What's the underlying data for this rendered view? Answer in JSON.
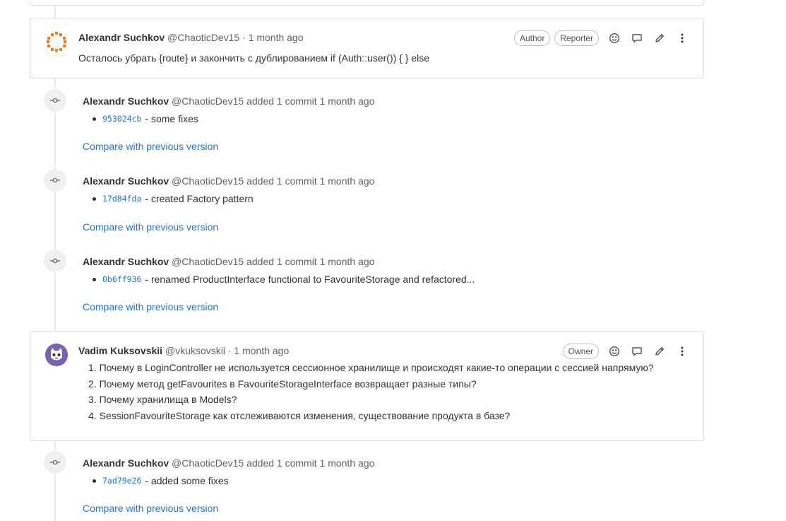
{
  "comment1": {
    "author": "Alexandr Suchkov",
    "handle": "@ChaoticDev15",
    "separator": "·",
    "time": "1 month ago",
    "badges": [
      "Author",
      "Reporter"
    ],
    "body": "Осталось убрать {route} и закончить с дублированием if (Auth::user()) { } else"
  },
  "system_notes": [
    {
      "author": "Alexandr Suchkov",
      "handle": "@ChaoticDev15",
      "action": "added 1 commit",
      "time": "1 month ago",
      "sha": "953024cb",
      "message": "- some fixes",
      "compare": "Compare with previous version"
    },
    {
      "author": "Alexandr Suchkov",
      "handle": "@ChaoticDev15",
      "action": "added 1 commit",
      "time": "1 month ago",
      "sha": "17d84fda",
      "message": "- created Factory pattern",
      "compare": "Compare with previous version"
    },
    {
      "author": "Alexandr Suchkov",
      "handle": "@ChaoticDev15",
      "action": "added 1 commit",
      "time": "1 month ago",
      "sha": "0b6ff936",
      "message": "- renamed ProductInterface functional to FavouriteStorage and refactored...",
      "compare": "Compare with previous version"
    },
    {
      "author": "Alexandr Suchkov",
      "handle": "@ChaoticDev15",
      "action": "added 1 commit",
      "time": "1 month ago",
      "sha": "7ad79e26",
      "message": "- added some fixes",
      "compare": "Compare with previous version"
    }
  ],
  "comment2": {
    "author": "Vadim Kuksovskii",
    "handle": "@vkuksovskii",
    "separator": "·",
    "time": "1 month ago",
    "badges": [
      "Owner"
    ],
    "items": [
      "1. Почему в LoginController не используется сессионное хранилище и происходят какие-то операции с сессией напрямую?",
      "2. Почему метод getFavourites в FavouriteStorageInterface возвращает разные типы?",
      "3. Почему хранилища в Models?",
      "4. SessionFavouriteStorage как отслеживаются изменения, существование продукта в базе?"
    ]
  },
  "icons": {
    "add_reaction": "smiley-icon",
    "reply": "comment-icon",
    "edit": "pencil-icon",
    "more": "kebab-icon",
    "commit": "commit-icon"
  }
}
